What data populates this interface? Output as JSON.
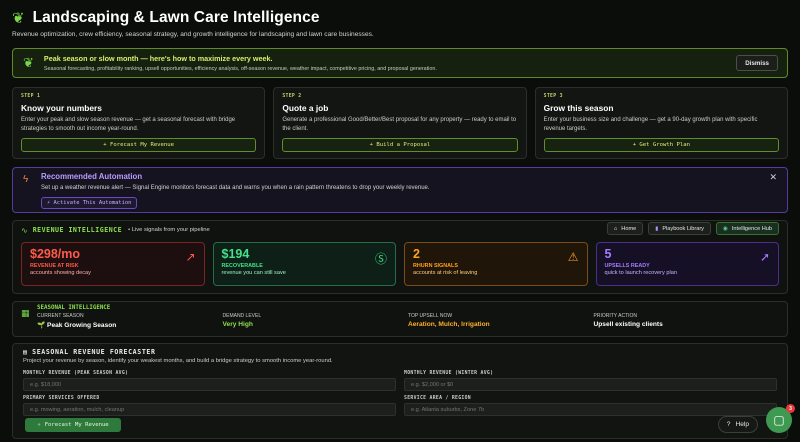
{
  "header": {
    "title": "Landscaping & Lawn Care Intelligence",
    "subtitle": "Revenue optimization, crew efficiency, seasonal strategy, and growth intelligence for landscaping and lawn care businesses."
  },
  "banner": {
    "title": "Peak season or slow month — here's how to maximize every week.",
    "desc": "Seasonal forecasting, profitability ranking, upsell opportunities, efficiency analysis, off-season revenue, weather impact, competitive pricing, and proposal generation.",
    "dismiss": "Dismiss"
  },
  "steps": [
    {
      "label": "STEP 1",
      "title": "Know your numbers",
      "desc": "Enter your peak and slow season revenue — get a seasonal forecast with bridge strategies to smooth out income year-round.",
      "button": "+ Forecast My Revenue"
    },
    {
      "label": "STEP 2",
      "title": "Quote a job",
      "desc": "Generate a professional Good/Better/Best proposal for any property — ready to email to the client.",
      "button": "+ Build a Proposal"
    },
    {
      "label": "STEP 3",
      "title": "Grow this season",
      "desc": "Enter your business size and challenge — get a 90-day growth plan with specific revenue targets.",
      "button": "+ Get Growth Plan"
    }
  ],
  "automation": {
    "title": "Recommended Automation",
    "desc": "Set up a weather revenue alert — Signal Engine monitors forecast data and warns you when a rain pattern threatens to drop your weekly revenue.",
    "button": "⚡ Activate This Automation"
  },
  "intel": {
    "title": "REVENUE INTELLIGENCE",
    "live": "• Live signals from your pipeline",
    "nav": {
      "home": "Home",
      "playbook": "Playbook Library",
      "hub": "Intelligence Hub"
    },
    "cards": [
      {
        "value": "$298/mo",
        "label": "REVENUE AT RISK",
        "sub": "accounts showing decay"
      },
      {
        "value": "$194",
        "label": "RECOVERABLE",
        "sub": "revenue you can still save"
      },
      {
        "value": "2",
        "label": "RHURN SIGNALS",
        "sub": "accounts at risk of leaving"
      },
      {
        "value": "5",
        "label": "UPSELLS READY",
        "sub": "quick to launch recovery plan"
      }
    ]
  },
  "seasonal": {
    "title": "SEASONAL INTELLIGENCE",
    "cols": [
      {
        "key": "CURRENT SEASON",
        "value": "🌱 Peak Growing Season"
      },
      {
        "key": "DEMAND LEVEL",
        "value": "Very High"
      },
      {
        "key": "TOP UPSELL NOW",
        "value": "Aeration, Mulch, Irrigation"
      },
      {
        "key": "PRIORITY ACTION",
        "value": "Upsell existing clients"
      }
    ]
  },
  "forecaster": {
    "title": "SEASONAL REVENUE FORECASTER",
    "desc": "Project your revenue by season, identify your weakest months, and build a bridge strategy to smooth income year-round.",
    "fields": [
      {
        "label": "MONTHLY REVENUE (PEAK SEASON AVG)",
        "placeholder": "e.g. $18,000"
      },
      {
        "label": "MONTHLY REVENUE (WINTER AVG)",
        "placeholder": "e.g. $2,000 or $0"
      },
      {
        "label": "PRIMARY SERVICES OFFERED",
        "placeholder": "e.g. mowing, aeration, mulch, cleanup"
      },
      {
        "label": "SERVICE AREA / REGION",
        "placeholder": "e.g. Atlanta suburbs, Zone 7b"
      }
    ],
    "button": "Forecast My Revenue"
  },
  "help": {
    "label": "Help",
    "badge": "3"
  },
  "colors": {
    "accent": "#7bd64b",
    "risk": "#ff5a4a",
    "recover": "#43e28a",
    "churn": "#ffa21e",
    "upsell": "#a77bff"
  }
}
